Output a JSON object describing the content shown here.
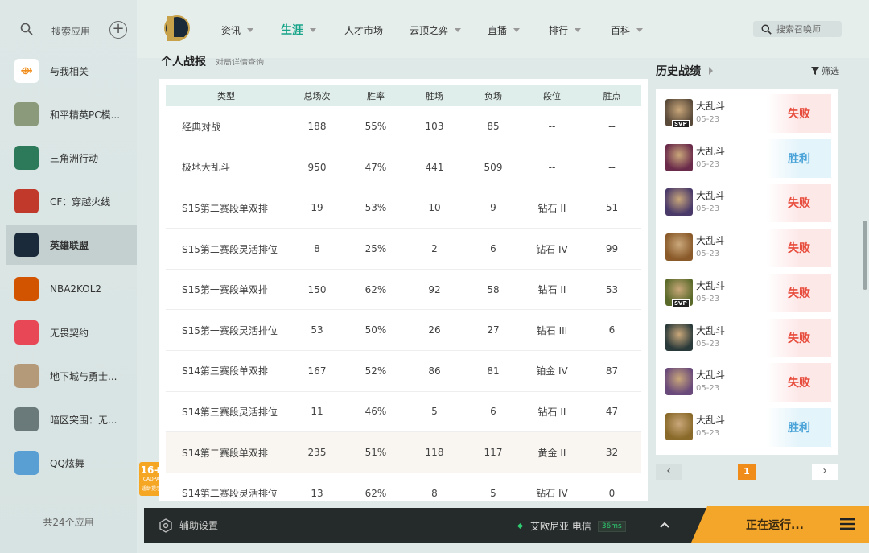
{
  "sidebar": {
    "search_label": "搜索应用",
    "items": [
      {
        "label": "与我相关",
        "icon": "related-icon",
        "color": "#ffffff"
      },
      {
        "label": "和平精英PC模...",
        "icon": "pubg-icon",
        "color": "#8a9a7a"
      },
      {
        "label": "三角洲行动",
        "icon": "delta-icon",
        "color": "#2d7a5a"
      },
      {
        "label": "CF：穿越火线",
        "icon": "cf-icon",
        "color": "#c0392b"
      },
      {
        "label": "英雄联盟",
        "icon": "lol-icon",
        "color": "#1a2a3a"
      },
      {
        "label": "NBA2KOL2",
        "icon": "nba-icon",
        "color": "#d35400"
      },
      {
        "label": "无畏契约",
        "icon": "valorant-icon",
        "color": "#e84855"
      },
      {
        "label": "地下城与勇士...",
        "icon": "dnf-icon",
        "color": "#b59a7a"
      },
      {
        "label": "暗区突围：无...",
        "icon": "arena-icon",
        "color": "#6a7a7a"
      },
      {
        "label": "QQ炫舞",
        "icon": "qqx5-icon",
        "color": "#5a9fd4"
      }
    ],
    "footer": "共24个应用"
  },
  "age_badge": {
    "age": "16+",
    "sub": "CADPA",
    "note": "适龄提示"
  },
  "topnav": {
    "items": [
      {
        "label": "资讯",
        "caret": true
      },
      {
        "label": "生涯",
        "caret": true,
        "active": true
      },
      {
        "label": "人才市场",
        "caret": false,
        "dot": true
      },
      {
        "label": "云顶之弈",
        "caret": true
      },
      {
        "label": "直播",
        "caret": true
      },
      {
        "label": "排行",
        "caret": true
      },
      {
        "label": "百科",
        "caret": true
      }
    ],
    "search_placeholder": "搜索召唤师"
  },
  "section": {
    "title": "个人战报",
    "subtitle": "对局详情查询"
  },
  "stats_table": {
    "headers": [
      "类型",
      "总场次",
      "胜率",
      "胜场",
      "负场",
      "段位",
      "胜点"
    ],
    "rows": [
      [
        "经典对战",
        "188",
        "55%",
        "103",
        "85",
        "--",
        "--"
      ],
      [
        "极地大乱斗",
        "950",
        "47%",
        "441",
        "509",
        "--",
        "--"
      ],
      [
        "S15第二赛段单双排",
        "19",
        "53%",
        "10",
        "9",
        "钻石 II",
        "51"
      ],
      [
        "S15第二赛段灵活排位",
        "8",
        "25%",
        "2",
        "6",
        "钻石 IV",
        "99"
      ],
      [
        "S15第一赛段单双排",
        "150",
        "62%",
        "92",
        "58",
        "钻石 II",
        "53"
      ],
      [
        "S15第一赛段灵活排位",
        "53",
        "50%",
        "26",
        "27",
        "钻石 III",
        "6"
      ],
      [
        "S14第三赛段单双排",
        "167",
        "52%",
        "86",
        "81",
        "铂金 IV",
        "87"
      ],
      [
        "S14第三赛段灵活排位",
        "11",
        "46%",
        "5",
        "6",
        "钻石 II",
        "47"
      ],
      [
        "S14第二赛段单双排",
        "235",
        "51%",
        "118",
        "117",
        "黄金 II",
        "32"
      ],
      [
        "S14第二赛段灵活排位",
        "13",
        "62%",
        "8",
        "5",
        "钻石 IV",
        "0"
      ]
    ],
    "highlight_row": 8
  },
  "history": {
    "title": "历史战绩",
    "filter_label": "筛选",
    "matches": [
      {
        "mode": "大乱斗",
        "date": "05-23",
        "result": "失败",
        "outcome": "loss",
        "svp": "SVP",
        "color": "#5a4a3a"
      },
      {
        "mode": "大乱斗",
        "date": "05-23",
        "result": "胜利",
        "outcome": "win",
        "svp": "",
        "color": "#6a2a4a"
      },
      {
        "mode": "大乱斗",
        "date": "05-23",
        "result": "失败",
        "outcome": "loss",
        "svp": "",
        "color": "#4a3a6a"
      },
      {
        "mode": "大乱斗",
        "date": "05-23",
        "result": "失败",
        "outcome": "loss",
        "svp": "",
        "color": "#8a5a2a"
      },
      {
        "mode": "大乱斗",
        "date": "05-23",
        "result": "失败",
        "outcome": "loss",
        "svp": "SVP",
        "color": "#5a6a2a"
      },
      {
        "mode": "大乱斗",
        "date": "05-23",
        "result": "失败",
        "outcome": "loss",
        "svp": "",
        "color": "#2a3a3a"
      },
      {
        "mode": "大乱斗",
        "date": "05-23",
        "result": "失败",
        "outcome": "loss",
        "svp": "",
        "color": "#6a4a7a"
      },
      {
        "mode": "大乱斗",
        "date": "05-23",
        "result": "胜利",
        "outcome": "win",
        "svp": "",
        "color": "#8a6a2a"
      }
    ],
    "pager": {
      "prev": "‹",
      "page": "1",
      "next": "›"
    }
  },
  "bottombar": {
    "helper_label": "辅助设置",
    "server": "艾欧尼亚 电信",
    "ping": "36ms",
    "run_label": "正在运行..."
  }
}
